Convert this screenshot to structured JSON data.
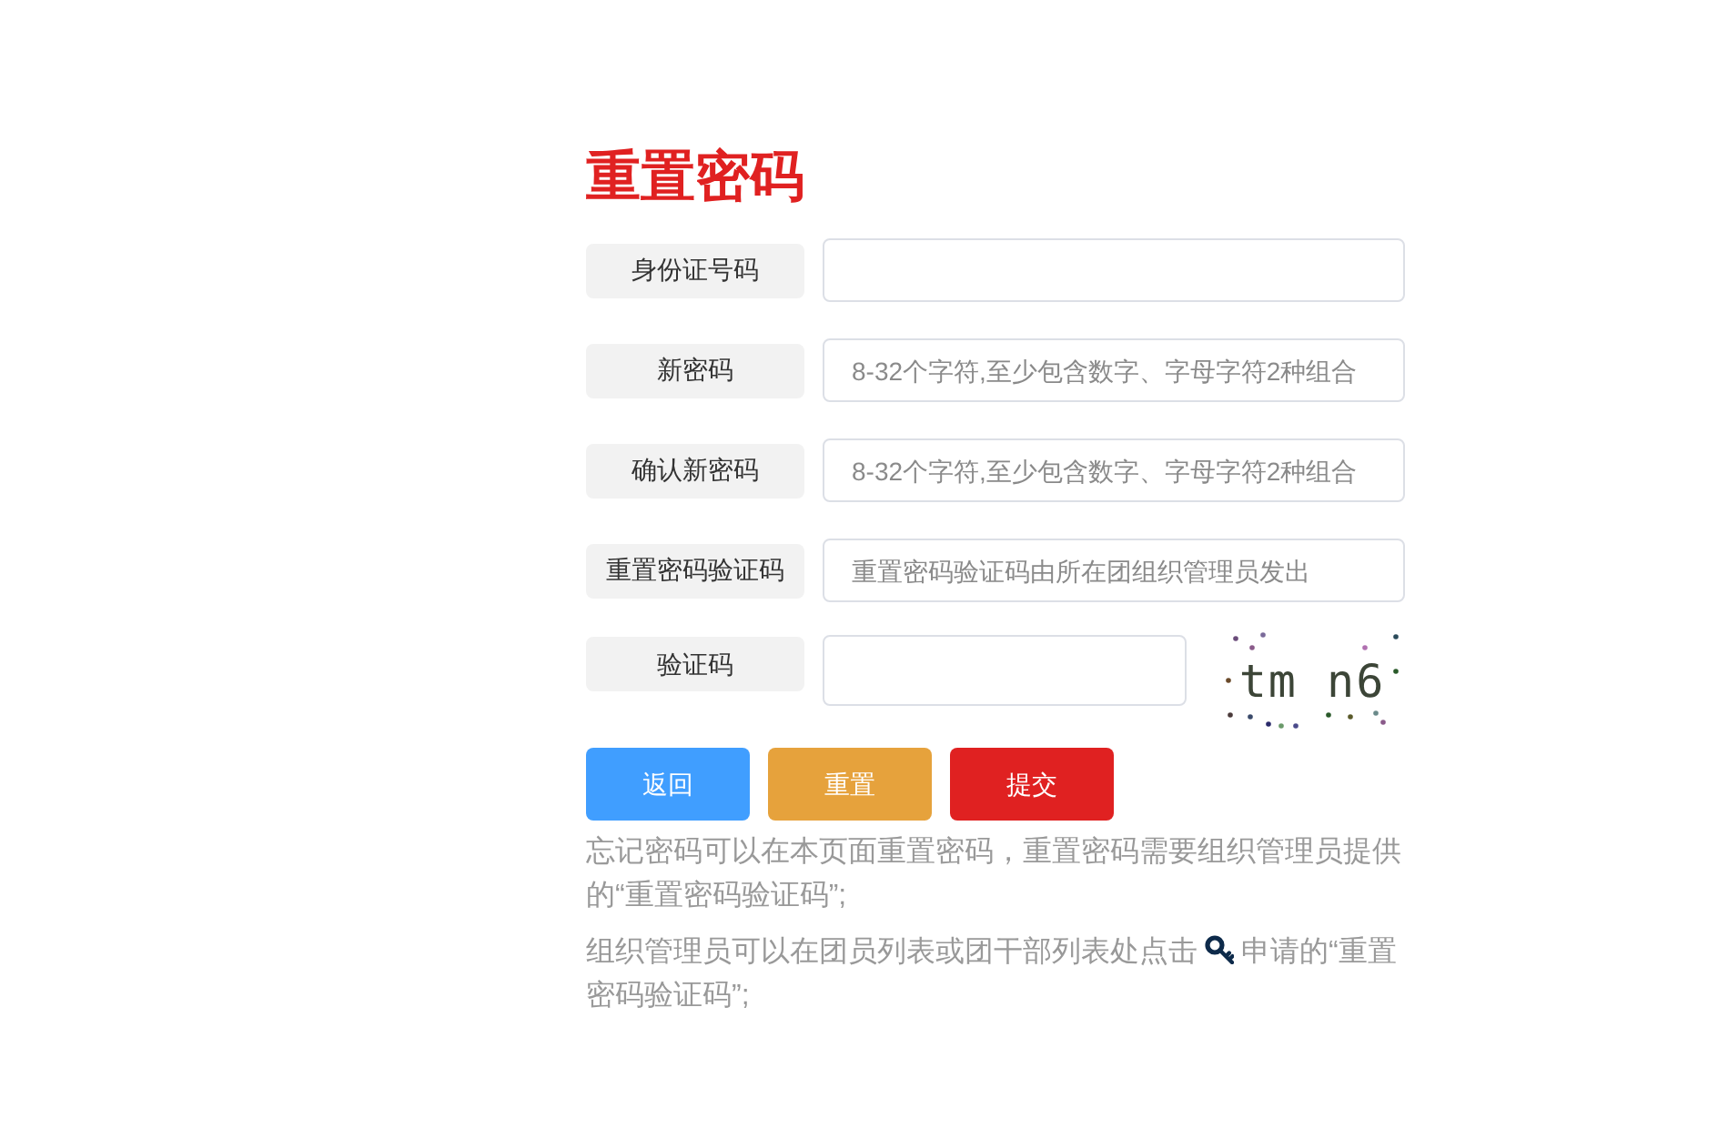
{
  "title": "重置密码",
  "fields": [
    {
      "kind": "text",
      "label": "身份证号码"
    },
    {
      "kind": "text",
      "label": "新密码",
      "placeholder": "8-32个字符,至少包含数字、字母字符2种组合"
    },
    {
      "kind": "text",
      "label": "确认新密码",
      "placeholder": "8-32个字符,至少包含数字、字母字符2种组合"
    },
    {
      "kind": "text",
      "label": "重置密码验证码",
      "placeholder": "重置密码验证码由所在团组织管理员发出"
    },
    {
      "kind": "captcha",
      "label": "验证码",
      "captcha_text": "tm n6"
    }
  ],
  "buttons": [
    {
      "label": "返回",
      "color": "#409eff"
    },
    {
      "label": "重置",
      "color": "#e6a23c"
    },
    {
      "label": "提交",
      "color": "#e02121"
    }
  ],
  "notes": [
    {
      "text": "忘记密码可以在本页面重置密码，重置密码需要组织管理员提供的“重置密码验证码”;"
    },
    {
      "text": "组织管理员可以在团员列表或团干部列表处点击",
      "text_after_icon": "申请的“重置密码验证码”;"
    }
  ]
}
